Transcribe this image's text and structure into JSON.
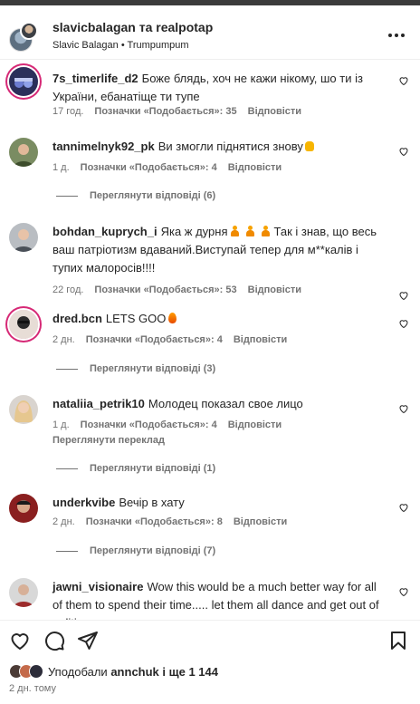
{
  "header": {
    "title": "slavicbalagan та realpotap",
    "subtitle": "Slavic Balagan • Trumpumpum",
    "more_icon": "more-horizontal-icon"
  },
  "comments": [
    {
      "username": "7s_timerlife_d2",
      "text": "Боже блядь, хоч не кажи нікому, шо ти із України, ебанатіще ти тупе",
      "time": "17 год.",
      "likes": "Позначки «Подобається»: 35",
      "reply": "Відповісти"
    },
    {
      "username": "tannimelnyk92_pk",
      "text": "Ви змогли піднятися знову",
      "time": "1 д.",
      "likes": "Позначки «Подобається»: 4",
      "reply": "Відповісти",
      "view_replies": "Переглянути відповіді (6)"
    },
    {
      "username": "bohdan_kuprych_i",
      "text_before": "Яка ж дурня",
      "text_after": "Так і знав, що весь ваш патріотизм вдаваний.Виступай тепер для м**калів і тупих малоросів!!!!",
      "time": "22 год.",
      "likes": "Позначки «Подобається»: 53",
      "reply": "Відповісти"
    },
    {
      "username": "dred.bcn",
      "text": "LETS GOO",
      "time": "2 дн.",
      "likes": "Позначки «Подобається»: 4",
      "reply": "Відповісти",
      "view_replies": "Переглянути відповіді (3)"
    },
    {
      "username": "nataliia_petrik10",
      "text": "Молодец показал свое лицо",
      "time": "1 д.",
      "likes": "Позначки «Подобається»: 4",
      "reply": "Відповісти",
      "translate": "Переглянути переклад",
      "view_replies": "Переглянути відповіді (1)"
    },
    {
      "username": "underkvibe",
      "text": "Вечір в хату",
      "time": "2 дн.",
      "likes": "Позначки «Подобається»: 8",
      "reply": "Відповісти",
      "view_replies": "Переглянути відповіді (7)"
    },
    {
      "username": "jawni_visionaire",
      "text": "Wow this would be a much better way for all of them to spend their time..... let them all dance and get out of politics"
    }
  ],
  "actions": {
    "like_icon": "heart-icon",
    "comment_icon": "comment-icon",
    "share_icon": "send-icon",
    "save_icon": "bookmark-icon"
  },
  "liked_by": {
    "prefix": "Уподобали",
    "user": "annchuk",
    "suffix": "і ще 1 144"
  },
  "post_date": "2 дн. тому",
  "colors": {
    "text": "#262626",
    "secondary": "#737373",
    "story_ring": "#d62976"
  }
}
